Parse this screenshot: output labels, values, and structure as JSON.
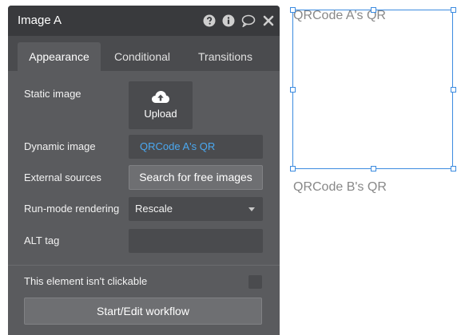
{
  "panel": {
    "title": "Image A",
    "header_icons": [
      "help-icon",
      "info-icon",
      "comment-icon",
      "close-icon"
    ],
    "tabs": [
      {
        "label": "Appearance",
        "active": true
      },
      {
        "label": "Conditional",
        "active": false
      },
      {
        "label": "Transitions",
        "active": false
      }
    ],
    "static_image": {
      "label": "Static image",
      "button_label": "Upload",
      "icon": "cloud-upload-icon"
    },
    "dynamic_image": {
      "label": "Dynamic image",
      "value": "QRCode A's QR"
    },
    "external_sources": {
      "label": "External sources",
      "button_label": "Search for free images"
    },
    "run_mode": {
      "label": "Run-mode rendering",
      "value": "Rescale"
    },
    "alt_tag": {
      "label": "ALT tag",
      "value": ""
    },
    "clickable": {
      "label": "This element isn't clickable",
      "checked": false
    },
    "workflow_button": "Start/Edit workflow"
  },
  "canvas": {
    "qr_a_label": "QRCode A's QR",
    "qr_b_label": "QRCode B's QR"
  },
  "colors": {
    "panel_bg": "#5a5b5e",
    "header_bg": "#393a3d",
    "link": "#4aa8f0",
    "selection": "#3b8be0"
  }
}
